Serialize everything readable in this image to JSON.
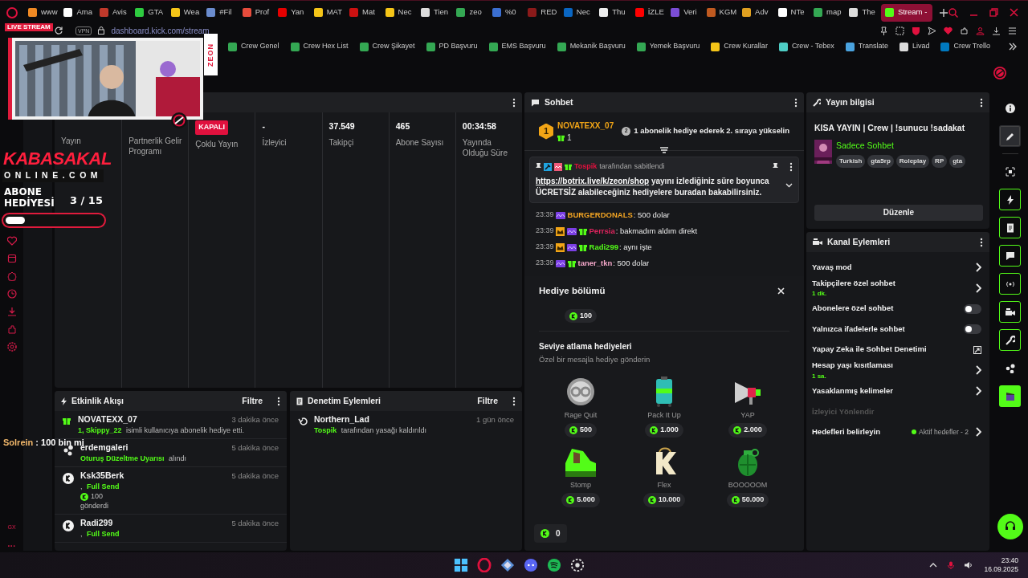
{
  "browser": {
    "tabs": [
      {
        "label": "www",
        "selected": false,
        "color": "#f08a24"
      },
      {
        "label": "Ama",
        "selected": false,
        "color": "#ffffff"
      },
      {
        "label": "Avis",
        "selected": false,
        "color": "#c0392b"
      },
      {
        "label": "GTA",
        "selected": false,
        "color": "#2ecc40"
      },
      {
        "label": "Wea",
        "selected": false,
        "color": "#f5c518"
      },
      {
        "label": "#Fil",
        "selected": false,
        "color": "#6b8cce"
      },
      {
        "label": "Prof",
        "selected": false,
        "color": "#e74c3c"
      },
      {
        "label": "Yan",
        "selected": false,
        "color": "#e60000"
      },
      {
        "label": "MAT",
        "selected": false,
        "color": "#f5c518"
      },
      {
        "label": "Mat",
        "selected": false,
        "color": "#cc1111"
      },
      {
        "label": "Nec",
        "selected": false,
        "color": "#f5c518"
      },
      {
        "label": "Tien",
        "selected": false,
        "color": "#dddddd"
      },
      {
        "label": "zeo",
        "selected": false,
        "color": "#34a853"
      },
      {
        "label": "%0",
        "selected": false,
        "color": "#3b6fd1"
      },
      {
        "label": "RED",
        "selected": false,
        "color": "#8b1a1a"
      },
      {
        "label": "Nec",
        "selected": false,
        "color": "#0a66c2"
      },
      {
        "label": "Thu",
        "selected": false,
        "color": "#eeeeee"
      },
      {
        "label": "İZLE",
        "selected": false,
        "color": "#ff0000"
      },
      {
        "label": "Veri",
        "selected": false,
        "color": "#7b4dd6"
      },
      {
        "label": "KGM",
        "selected": false,
        "color": "#c05a20"
      },
      {
        "label": "Adv",
        "selected": false,
        "color": "#e0a020"
      },
      {
        "label": "NTe",
        "selected": false,
        "color": "#ffffff"
      },
      {
        "label": "map",
        "selected": false,
        "color": "#34a853"
      },
      {
        "label": "The",
        "selected": false,
        "color": "#dddddd"
      },
      {
        "label": "Stream -",
        "selected": true,
        "color": "#53fc18"
      }
    ],
    "vpn": "VPN",
    "address": "dashboard.kick.com/stream",
    "bookmarks": [
      {
        "label": "Crew Genel",
        "color": "#34a853"
      },
      {
        "label": "Crew Hex List",
        "color": "#34a853"
      },
      {
        "label": "Crew Şikayet",
        "color": "#34a853"
      },
      {
        "label": "PD Başvuru",
        "color": "#34a853"
      },
      {
        "label": "EMS Başvuru",
        "color": "#34a853"
      },
      {
        "label": "Mekanik Başvuru",
        "color": "#34a853"
      },
      {
        "label": "Yemek Başvuru",
        "color": "#34a853"
      },
      {
        "label": "Crew Kurallar",
        "color": "#f5c518"
      },
      {
        "label": "Crew - Tebex",
        "color": "#4ecdc4"
      },
      {
        "label": "Translate",
        "color": "#4aa3df"
      },
      {
        "label": "Livad",
        "color": "#dddddd"
      },
      {
        "label": "Crew Trello",
        "color": "#0079bf"
      }
    ],
    "sidebar_footer": [
      "GX",
      "···"
    ]
  },
  "overlay": {
    "live_badge": "LIVE STREAM",
    "side_text": "ZEON",
    "logo_title": "KABASAKAL",
    "logo_subtitle": "ONLINE.COM",
    "goal_label": "ABONE HEDİYESİ",
    "goal_count": "3 / 15",
    "level": 0.2,
    "chat_user": "Solrein",
    "chat_text": ": 100 bin mi"
  },
  "stats": [
    {
      "label": "Yayın"
    },
    {
      "label": "Partnerlik Gelir Programı"
    },
    {
      "badge": "KAPALI",
      "label": "Çoklu Yayın"
    },
    {
      "value": "-",
      "label": "İzleyici"
    },
    {
      "value": "37.549",
      "label": "Takipçi"
    },
    {
      "value": "465",
      "label": "Abone Sayısı"
    },
    {
      "value": "00:34:58",
      "label": "Yayında Olduğu Süre"
    }
  ],
  "chat": {
    "title": "Sohbet",
    "leader": {
      "rank": "1",
      "user": "NOVATEXX_07",
      "gifts": "1",
      "next_rank": "2",
      "promo": "1 abonelik hediye ederek 2. sıraya yükselin"
    },
    "pinned": {
      "by": "Tospik",
      "by_text": "tarafından sabitlendi",
      "link": "https://botrix.live/k/zeon/shop",
      "text": " yayını izlediğiniz süre boyunca ÜCRETSİZ alabileceğiniz hediyelere buradan bakabilirsiniz."
    },
    "messages": [
      {
        "time": "23:39",
        "crown": false,
        "subscriber": true,
        "gifter": false,
        "user": "BURGERDONALS",
        "color": "#f5a623",
        "text": ": 500 dolar"
      },
      {
        "time": "23:39",
        "crown": true,
        "subscriber": true,
        "gifter": true,
        "user": "Perrsia",
        "color": "#e0245e",
        "text": ": bakmadım aldım direkt"
      },
      {
        "time": "23:39",
        "crown": true,
        "subscriber": true,
        "gifter": true,
        "user": "Radi299",
        "color": "#53fc18",
        "text": ": aynı işte"
      },
      {
        "time": "23:39",
        "crown": false,
        "subscriber": true,
        "gifter": true,
        "user": "taner_tkn",
        "color": "#f3a6c8",
        "text": ": 500 dolar"
      }
    ],
    "gifts": {
      "title": "Hediye bölümü",
      "top_price": "100",
      "section_title": "Seviye atlama hediyeleri",
      "section_subtitle": "Özel bir mesajla hediye gönderin",
      "items": [
        {
          "name": "Rage Quit",
          "price": "500"
        },
        {
          "name": "Pack It Up",
          "price": "1.000"
        },
        {
          "name": "YAP",
          "price": "2.000"
        },
        {
          "name": "Stomp",
          "price": "5.000"
        },
        {
          "name": "Flex",
          "price": "10.000"
        },
        {
          "name": "BOOOOOM",
          "price": "50.000"
        }
      ],
      "balance": "0"
    }
  },
  "events": {
    "title": "Etkinlik Akışı",
    "filter": "Filtre",
    "items": [
      {
        "kind": "gift",
        "user": "NOVATEXX_07",
        "time": "3 dakika önce",
        "lines": [
          [
            {
              "text": "1, Skippy_22",
              "highlight": true
            },
            {
              "text": " isimli kullanıcıya abonelik hediye etti.",
              "highlight": false
            }
          ]
        ]
      },
      {
        "kind": "dots",
        "user": "erdemgaleri",
        "time": "5 dakika önce",
        "lines": [
          [
            {
              "text": "Oturuş Düzeltme Uyarısı",
              "highlight": true
            },
            {
              "text": " alındı",
              "highlight": false
            }
          ]
        ]
      },
      {
        "kind": "kick",
        "user": "Ksk35Berk",
        "time": "5 dakika önce",
        "lines": [
          [
            {
              "text": ",",
              "highlight": false
            },
            {
              "text": " Full Send",
              "highlight": true
            }
          ],
          [
            {
              "text": "100",
              "highlight": false,
              "coin": true
            }
          ],
          [
            {
              "text": "gönderdi",
              "highlight": false
            }
          ]
        ]
      },
      {
        "kind": "kick",
        "user": "Radi299",
        "time": "5 dakika önce",
        "lines": [
          [
            {
              "text": ",",
              "highlight": false
            },
            {
              "text": " Full Send",
              "highlight": true
            }
          ]
        ]
      }
    ]
  },
  "moderation": {
    "title": "Denetim Eylemleri",
    "filter": "Filtre",
    "items": [
      {
        "user": "Northern_Lad",
        "time": "1 gün önce",
        "lines": [
          [
            {
              "text": "Tospik",
              "highlight": true
            },
            {
              "text": " tarafından yasağı kaldırıldı",
              "highlight": false
            }
          ]
        ]
      }
    ]
  },
  "stream_info": {
    "title": "Yayın bilgisi",
    "stream_title": "KISA YAYIN | Crew | !sunucu !sadakat",
    "category": "Sadece Sohbet",
    "tags": [
      "Turkish",
      "gta5rp",
      "Roleplay",
      "RP",
      "gta"
    ],
    "edit": "Düzenle"
  },
  "channel_actions": {
    "title": "Kanal Eylemleri",
    "items": [
      {
        "kind": "link",
        "label": "Yavaş mod"
      },
      {
        "kind": "link",
        "label": "Takipçilere özel sohbet",
        "detail": "1 dk."
      },
      {
        "kind": "toggle",
        "label": "Abonelere özel sohbet",
        "on": false
      },
      {
        "kind": "toggle",
        "label": "Yalnızca ifadelerle sohbet",
        "on": false
      },
      {
        "kind": "external",
        "label": "Yapay Zeka ile Sohbet Denetimi"
      },
      {
        "kind": "link",
        "label": "Hesap yaşı kısıtlaması",
        "detail": "1 sa."
      },
      {
        "kind": "link",
        "label": "Yasaklanmış kelimeler"
      },
      {
        "kind": "heading",
        "label": "İzleyici Yönlendir"
      },
      {
        "kind": "goal",
        "label": "Hedefleri belirleyin",
        "status": "Aktif hedefler - 2"
      }
    ]
  },
  "tool_rail": [
    {
      "selected": false,
      "enabled": false,
      "active": false
    },
    {
      "selected": true,
      "enabled": false,
      "active": false
    },
    {
      "selected": false,
      "enabled": false,
      "active": false
    },
    {
      "selected": false,
      "enabled": true,
      "active": false
    },
    {
      "selected": false,
      "enabled": true,
      "active": false
    },
    {
      "selected": false,
      "enabled": true,
      "active": false
    },
    {
      "selected": false,
      "enabled": true,
      "active": false
    },
    {
      "selected": false,
      "enabled": true,
      "active": false
    },
    {
      "selected": false,
      "enabled": true,
      "active": false
    },
    {
      "selected": false,
      "enabled": false,
      "active": false
    },
    {
      "selected": false,
      "enabled": false,
      "active": true
    }
  ],
  "taskbar": {
    "time": "23:40",
    "date": "16.09.2025"
  }
}
